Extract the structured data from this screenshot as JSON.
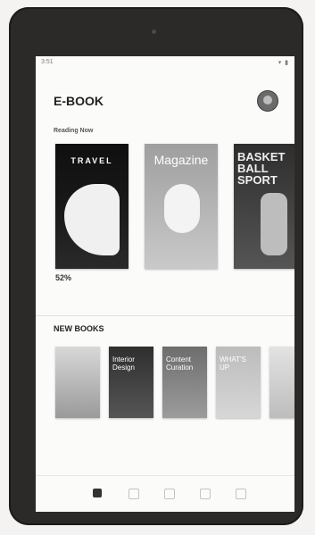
{
  "statusbar": {
    "time": "3:51",
    "icons": "▾ ▮"
  },
  "header": {
    "title": "E-BOOK"
  },
  "reading_now": {
    "section_label": "Reading Now",
    "books": [
      {
        "cover_text": "TRAVEL",
        "progress": "52%",
        "meta_title": "",
        "meta_author": "",
        "meta_pages": ""
      },
      {
        "cover_text": "Magazine",
        "progress": "",
        "meta_title": "",
        "meta_author": "",
        "meta_pages": ""
      },
      {
        "cover_text": "BASKET BALL SPORT",
        "progress": "",
        "meta_title": "",
        "meta_author": "",
        "meta_pages": ""
      }
    ]
  },
  "new_books": {
    "section_label": "NEW BOOKS",
    "books": [
      {
        "cover_text": "",
        "label": ""
      },
      {
        "cover_text": "Interior Design",
        "label": ""
      },
      {
        "cover_text": "Content Curation",
        "label": ""
      },
      {
        "cover_text": "WHAT'S UP",
        "label": ""
      },
      {
        "cover_text": "",
        "label": ""
      }
    ]
  },
  "bottom_nav": {
    "items": [
      "book-icon",
      "library-icon",
      "bookmark-icon",
      "download-icon",
      "settings-icon"
    ]
  }
}
